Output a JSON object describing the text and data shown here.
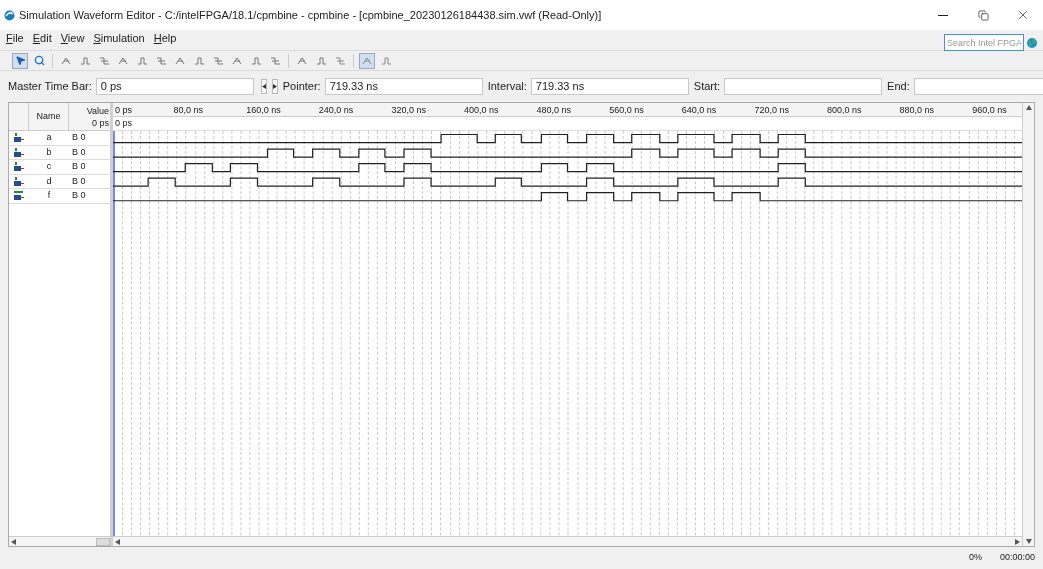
{
  "window": {
    "title": "Simulation Waveform Editor - C:/intelFPGA/18.1/cpmbine - cpmbine - [cpmbine_20230126184438.sim.vwf (Read-Only)]"
  },
  "menu": [
    {
      "label": "File"
    },
    {
      "label": "Edit"
    },
    {
      "label": "View"
    },
    {
      "label": "Simulation"
    },
    {
      "label": "Help"
    }
  ],
  "search": {
    "placeholder": "Search Intel FPGA"
  },
  "toolbar": [
    {
      "selected": true
    },
    {
      "selected": false
    },
    {
      "selected": false
    },
    {
      "selected": false
    },
    {
      "selected": false
    },
    {
      "selected": false
    },
    {
      "selected": false
    },
    {
      "selected": false
    },
    {
      "selected": false
    },
    {
      "selected": false
    },
    {
      "selected": false
    },
    {
      "selected": false
    },
    {
      "selected": false
    },
    {
      "selected": false
    },
    {
      "selected": false
    },
    {
      "selected": false
    },
    {
      "selected": false
    },
    {
      "selected": true
    },
    {
      "selected": false
    }
  ],
  "time_fields": {
    "master_time_bar": {
      "label": "Master Time Bar:",
      "value": "0 ps"
    },
    "pointer": {
      "label": "Pointer:",
      "value": "719.33 ns"
    },
    "interval": {
      "label": "Interval:",
      "value": "719.33 ns"
    },
    "start": {
      "label": "Start:"
    },
    "end": {
      "label": "End:"
    }
  },
  "columns": {
    "name": "Name",
    "value": "Value",
    "value_time": "0 ps"
  },
  "ruler": {
    "ticks": [
      "0 ps",
      "80,0 ns",
      "160,0 ns",
      "240,0 ns",
      "320,0 ns",
      "400,0 ns",
      "480,0 ns",
      "560,0 ns",
      "640,0 ns",
      "720,0 ns",
      "800,0 ns",
      "880,0 ns",
      "960,0 ns"
    ],
    "master_label": "0 ps"
  },
  "signals": [
    {
      "kind": "input",
      "name": "a",
      "value": "B 0"
    },
    {
      "kind": "input",
      "name": "b",
      "value": "B 0"
    },
    {
      "kind": "input",
      "name": "c",
      "value": "B 0"
    },
    {
      "kind": "input",
      "name": "d",
      "value": "B 0"
    },
    {
      "kind": "output",
      "name": "f",
      "value": "B 0"
    }
  ],
  "status_bar": {
    "progress": "0%",
    "elapsed": "00:00:00"
  }
}
